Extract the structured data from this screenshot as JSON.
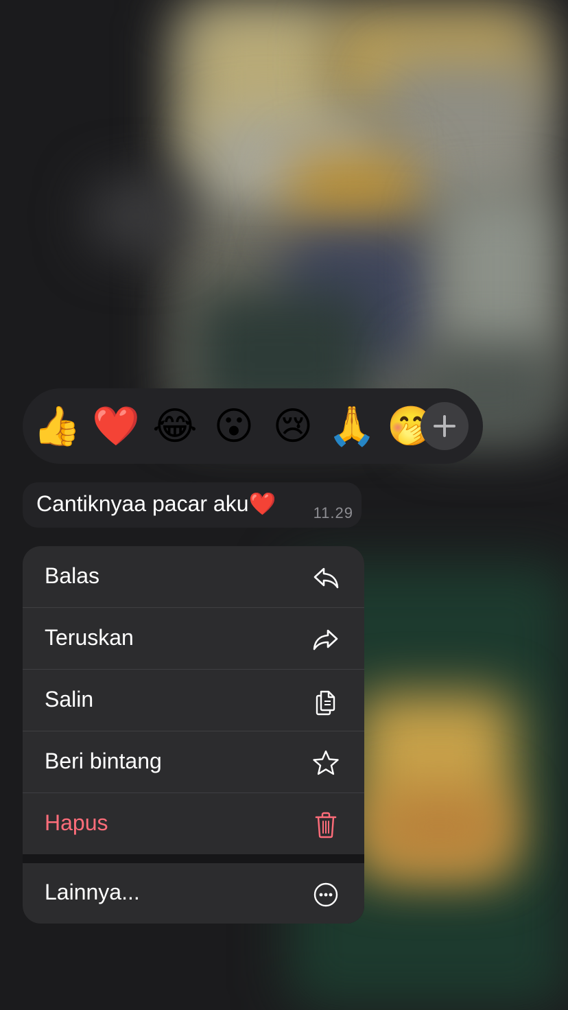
{
  "reactions": {
    "emojis": [
      {
        "name": "thumbs-up",
        "glyph": "👍"
      },
      {
        "name": "red-heart",
        "glyph": "❤️"
      },
      {
        "name": "tears-of-joy",
        "glyph": "😂"
      },
      {
        "name": "surprised",
        "glyph": "😮"
      },
      {
        "name": "crying",
        "glyph": "😢"
      },
      {
        "name": "folded-hands",
        "glyph": "🙏"
      },
      {
        "name": "face-with-hand",
        "glyph": "🤭"
      }
    ],
    "add_icon": "plus-icon"
  },
  "message": {
    "text": "Cantiknyaa pacar aku❤️",
    "time": "11.29"
  },
  "menu": {
    "reply": {
      "label": "Balas",
      "icon": "reply-icon"
    },
    "forward": {
      "label": "Teruskan",
      "icon": "forward-icon"
    },
    "copy": {
      "label": "Salin",
      "icon": "copy-icon"
    },
    "star": {
      "label": "Beri bintang",
      "icon": "star-icon"
    },
    "delete": {
      "label": "Hapus",
      "icon": "trash-icon",
      "color": "#ff6d7a"
    },
    "more": {
      "label": "Lainnya...",
      "icon": "more-icon"
    }
  }
}
